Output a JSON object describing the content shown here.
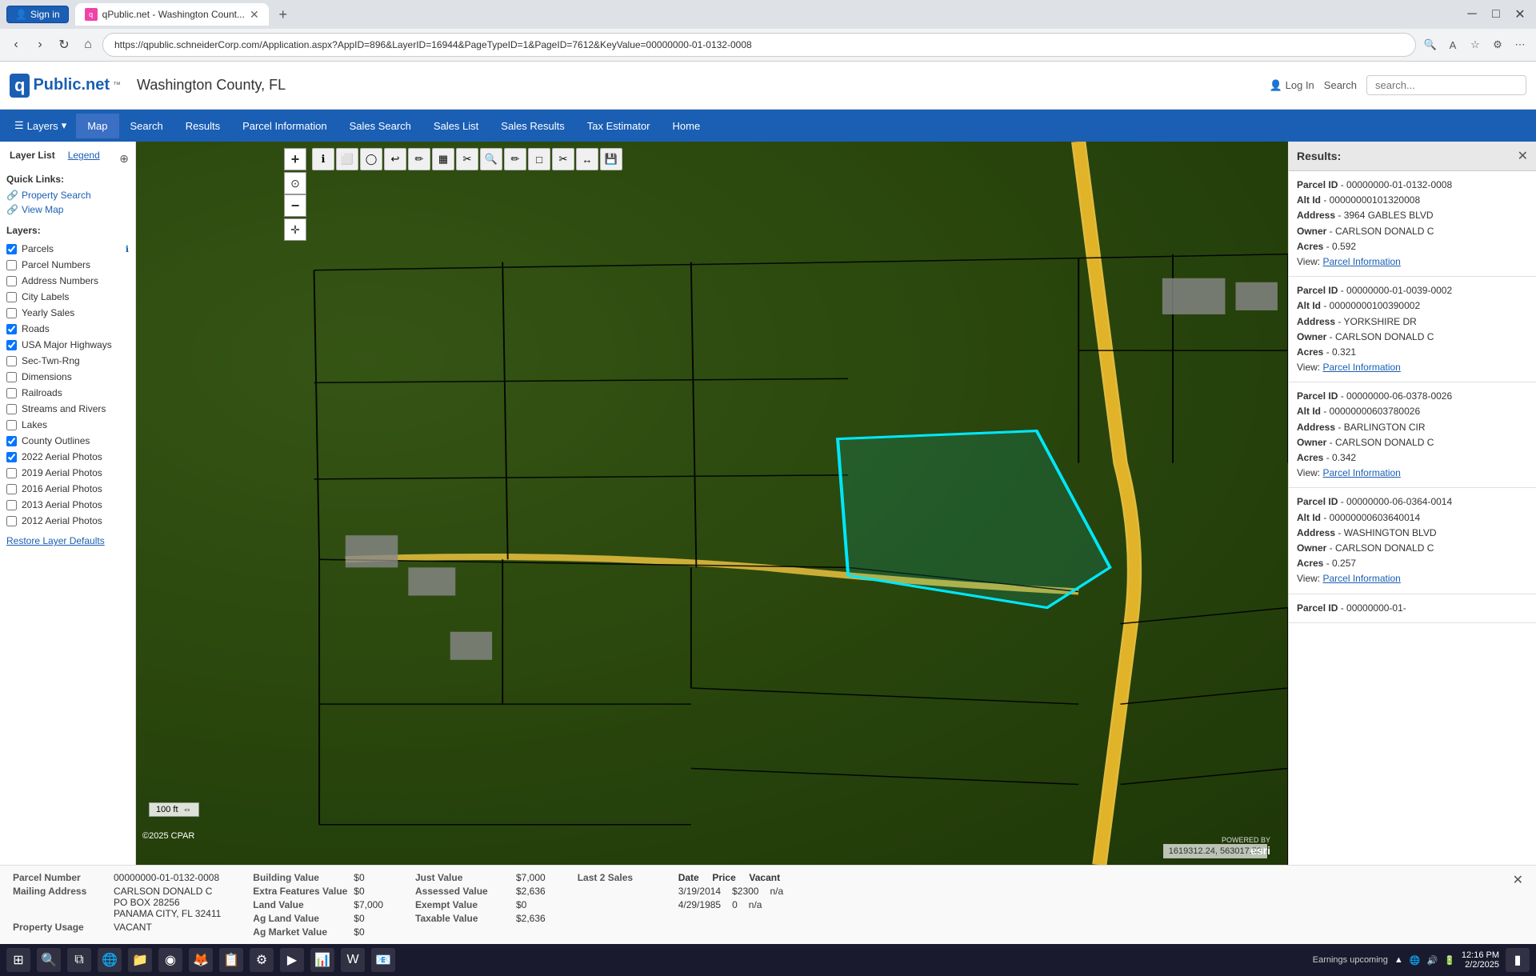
{
  "browser": {
    "url": "https://qpublic.schneiderCorp.com/Application.aspx?AppID=896&LayerID=16944&PageTypeID=1&PageID=7612&KeyValue=00000000-01-0132-0008",
    "tab_title": "qPublic.net - Washington Count...",
    "sign_in": "Sign in"
  },
  "header": {
    "logo_q": "q",
    "logo_text": "Public.net",
    "logo_tm": "™",
    "title": "Washington County, FL",
    "login_label": "Log In",
    "search_label": "Search",
    "search_placeholder": "search..."
  },
  "nav": {
    "layers_label": "Layers",
    "items": [
      "Map",
      "Search",
      "Results",
      "Parcel Information",
      "Sales Search",
      "Sales List",
      "Sales Results",
      "Tax Estimator",
      "Home"
    ]
  },
  "sidebar": {
    "tab_layer_list": "Layer List",
    "tab_legend": "Legend",
    "quick_links_title": "Quick Links:",
    "property_search": "Property Search",
    "view_map": "View Map",
    "layers_title": "Layers:",
    "layers": [
      {
        "label": "Parcels",
        "checked": true,
        "has_info": true
      },
      {
        "label": "Parcel Numbers",
        "checked": false,
        "has_info": false
      },
      {
        "label": "Address Numbers",
        "checked": false,
        "has_info": false
      },
      {
        "label": "City Labels",
        "checked": false,
        "has_info": false
      },
      {
        "label": "Yearly Sales",
        "checked": false,
        "has_info": false
      },
      {
        "label": "Roads",
        "checked": true,
        "has_info": false
      },
      {
        "label": "USA Major Highways",
        "checked": true,
        "has_info": false
      },
      {
        "label": "Sec-Twn-Rng",
        "checked": false,
        "has_info": false
      },
      {
        "label": "Dimensions",
        "checked": false,
        "has_info": false
      },
      {
        "label": "Railroads",
        "checked": false,
        "has_info": false
      },
      {
        "label": "Streams and Rivers",
        "checked": false,
        "has_info": false
      },
      {
        "label": "Lakes",
        "checked": false,
        "has_info": false
      },
      {
        "label": "County Outlines",
        "checked": true,
        "has_info": false
      },
      {
        "label": "2022 Aerial Photos",
        "checked": true,
        "has_info": false
      },
      {
        "label": "2019 Aerial Photos",
        "checked": false,
        "has_info": false
      },
      {
        "label": "2016 Aerial Photos",
        "checked": false,
        "has_info": false
      },
      {
        "label": "2013 Aerial Photos",
        "checked": false,
        "has_info": false
      },
      {
        "label": "2012 Aerial Photos",
        "checked": false,
        "has_info": false
      }
    ],
    "restore_label": "Restore Layer Defaults"
  },
  "map": {
    "scale_label": "100 ft",
    "coords": "1619312.24, 563017.52",
    "zoom_in": "+",
    "zoom_out": "−",
    "tools": [
      "ℹ",
      "✏",
      "⭕",
      "↩",
      "✏",
      "▦",
      "✂",
      "🔍",
      "✏",
      "⬜",
      "✂",
      "↔",
      "💾"
    ]
  },
  "results": {
    "title": "Results:",
    "items": [
      {
        "parcel_id_label": "Parcel ID",
        "parcel_id": "00000000-01-0132-0008",
        "alt_id_label": "Alt Id",
        "alt_id": "00000000101320008",
        "address_label": "Address",
        "address": "3964 GABLES BLVD",
        "owner_label": "Owner",
        "owner": "CARLSON DONALD C",
        "acres_label": "Acres",
        "acres": "0.592",
        "view_label": "View:",
        "view_link": "Parcel Information"
      },
      {
        "parcel_id_label": "Parcel ID",
        "parcel_id": "00000000-01-0039-0002",
        "alt_id_label": "Alt Id",
        "alt_id": "00000000100390002",
        "address_label": "Address",
        "address": "YORKSHIRE DR",
        "owner_label": "Owner",
        "owner": "CARLSON DONALD C",
        "acres_label": "Acres",
        "acres": "0.321",
        "view_label": "View:",
        "view_link": "Parcel Information"
      },
      {
        "parcel_id_label": "Parcel ID",
        "parcel_id": "00000000-06-0378-0026",
        "alt_id_label": "Alt Id",
        "alt_id": "00000000603780026",
        "address_label": "Address",
        "address": "BARLINGTON CIR",
        "owner_label": "Owner",
        "owner": "CARLSON DONALD C",
        "acres_label": "Acres",
        "acres": "0.342",
        "view_label": "View:",
        "view_link": "Parcel Information"
      },
      {
        "parcel_id_label": "Parcel ID",
        "parcel_id": "00000000-06-0364-0014",
        "alt_id_label": "Alt Id",
        "alt_id": "00000000603640014",
        "address_label": "Address",
        "address": "WASHINGTON BLVD",
        "owner_label": "Owner",
        "owner": "CARLSON DONALD C",
        "acres_label": "Acres",
        "acres": "0.257",
        "view_label": "View:",
        "view_link": "Parcel Information"
      },
      {
        "parcel_id_label": "Parcel ID",
        "parcel_id": "00000000-01-",
        "alt_id_label": "",
        "alt_id": "",
        "address_label": "",
        "address": "",
        "owner_label": "",
        "owner": "",
        "acres_label": "",
        "acres": "",
        "view_label": "",
        "view_link": ""
      }
    ]
  },
  "bottom_panel": {
    "parcel_number_label": "Parcel Number",
    "parcel_number": "00000000-01-0132-0008",
    "mailing_address_label": "Mailing Address",
    "mailing_address_line1": "CARLSON DONALD C",
    "mailing_address_line2": "PO BOX 28256",
    "mailing_address_line3": "PANAMA CITY, FL 32411",
    "property_usage_label": "Property Usage",
    "property_usage": "VACANT",
    "building_value_label": "Building Value",
    "building_value": "$0",
    "extra_features_label": "Extra Features Value",
    "extra_features": "$0",
    "land_value_label": "Land Value",
    "land_value": "$7,000",
    "ag_land_value_label": "Ag Land Value",
    "ag_land_value": "$0",
    "ag_market_label": "Ag Market Value",
    "ag_market": "$0",
    "just_value_label": "Just Value",
    "just_value": "$7,000",
    "assessed_value_label": "Assessed Value",
    "assessed_value": "$2,636",
    "exempt_value_label": "Exempt Value",
    "exempt_value": "$0",
    "taxable_value_label": "Taxable Value",
    "taxable_value": "$2,636",
    "last_2_sales_label": "Last 2 Sales",
    "sale1_date": "3/19/2014",
    "sale1_price": "$2300",
    "sale1_vacant": "n/a",
    "sale2_date": "4/29/1985",
    "sale2_price": "0",
    "sale2_vacant": "n/a"
  },
  "taskbar": {
    "time": "12:16 PM",
    "date": "2/2/2025",
    "notification": "Earnings upcoming"
  },
  "copyright": "©2025 CPAR"
}
